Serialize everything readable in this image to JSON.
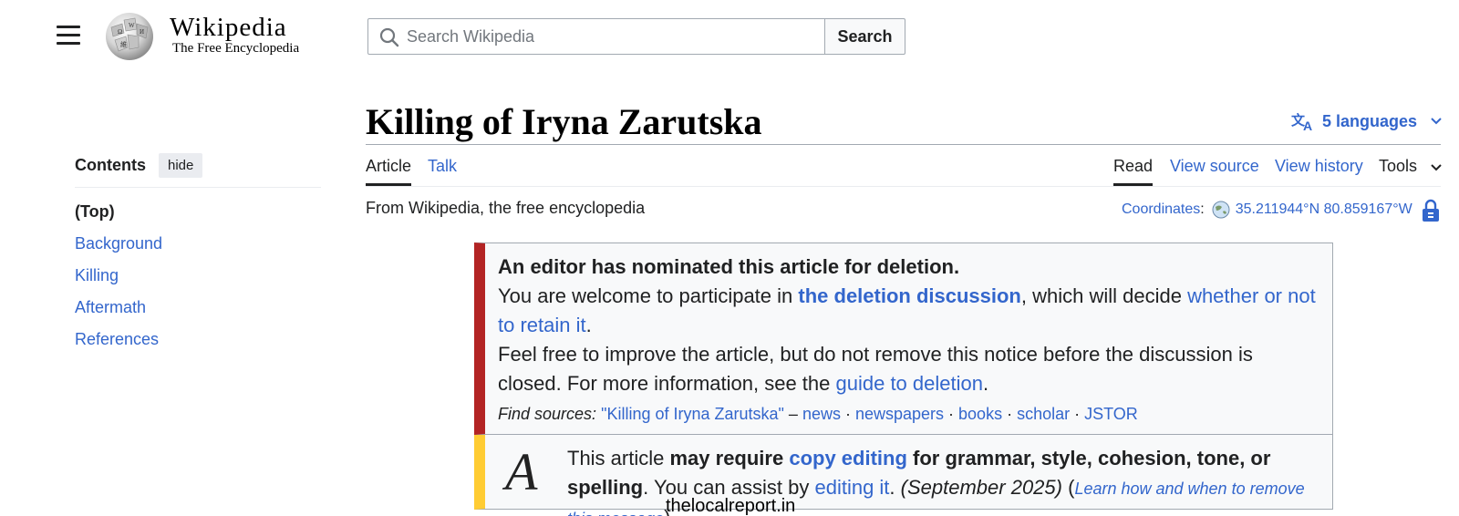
{
  "header": {
    "wordmark": "Wikipedia",
    "tagline": "The Free Encyclopedia",
    "search_placeholder": "Search Wikipedia",
    "search_button": "Search"
  },
  "toc": {
    "title": "Contents",
    "hide": "hide",
    "items": [
      "(Top)",
      "Background",
      "Killing",
      "Aftermath",
      "References"
    ]
  },
  "article": {
    "title": "Killing of Iryna Zarutska",
    "languages": "5 languages",
    "tabs": {
      "article": "Article",
      "talk": "Talk",
      "read": "Read",
      "view_source": "View source",
      "view_history": "View history",
      "tools": "Tools"
    },
    "from": "From Wikipedia, the free encyclopedia",
    "coords_label": "Coordinates",
    "coords_value": "35.211944°N 80.859167°W"
  },
  "afd_notice": {
    "heading": "An editor has nominated this article for deletion.",
    "p1_a": "You are welcome to participate in ",
    "p1_link": "the deletion discussion",
    "p1_b": ", which will decide ",
    "p1_link2": "whether or not to retain it",
    "p1_c": ".",
    "p2_a": "Feel free to improve the article, but do not remove this notice before the discussion is closed. For more information, see the ",
    "p2_link": "guide to deletion",
    "p2_b": ".",
    "find_label": "Find sources:",
    "find_query": "\"Killing of Iryna Zarutska\"",
    "find_dash": " – ",
    "sources": [
      "news",
      "newspapers",
      "books",
      "scholar",
      "JSTOR"
    ]
  },
  "copy_notice": {
    "icon_glyph": "A",
    "t1": "This article ",
    "t2": "may require ",
    "t3": "copy editing",
    "t4": " for grammar, style, cohesion, tone, or spelling",
    "t5": ". You can assist by ",
    "t6": "editing it",
    "t7": ". ",
    "date": "(September 2025)",
    "learn_open": " (",
    "learn": "Learn how and when to remove this message",
    "learn_close": ")"
  },
  "watermark": "thelocalreport.in",
  "colors": {
    "link": "#3366cc",
    "afd_bar": "#b32424",
    "copy_bar": "#ffcc33",
    "text": "#202122"
  }
}
